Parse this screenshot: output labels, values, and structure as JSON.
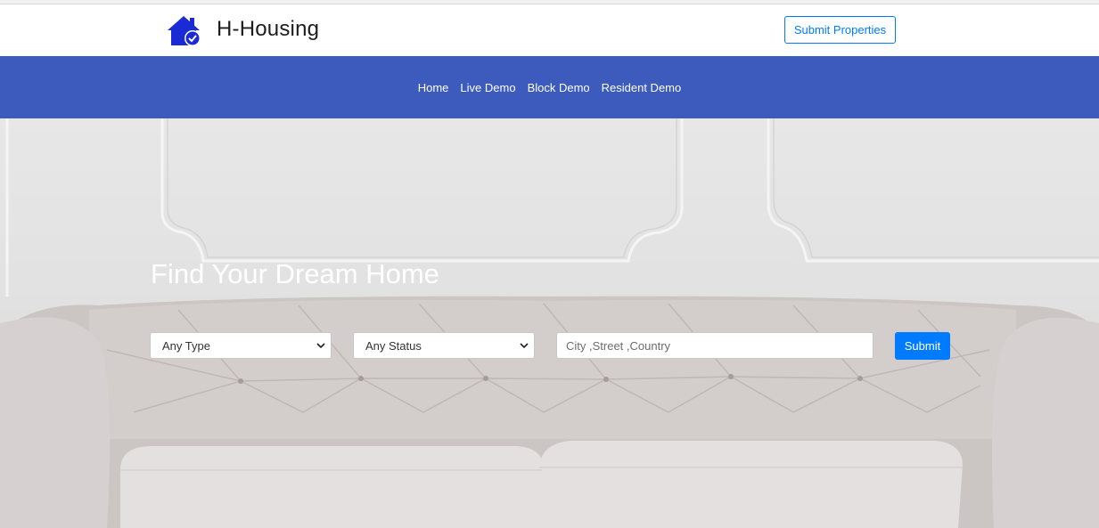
{
  "header": {
    "brand": "H-Housing",
    "logo_icon": "house-check-icon",
    "submit_properties_label": "Submit Properties",
    "accent_color": "#007bff"
  },
  "nav": {
    "background": "#3d5bbd",
    "items": [
      {
        "label": "Home"
      },
      {
        "label": "Live Demo"
      },
      {
        "label": "Block Demo"
      },
      {
        "label": "Resident Demo"
      }
    ]
  },
  "hero": {
    "title": "Find Your Dream Home",
    "type_select": {
      "selected": "Any Type"
    },
    "status_select": {
      "selected": "Any Status"
    },
    "search": {
      "placeholder": "City ,Street ,Country",
      "value": ""
    },
    "submit_label": "Submit"
  }
}
